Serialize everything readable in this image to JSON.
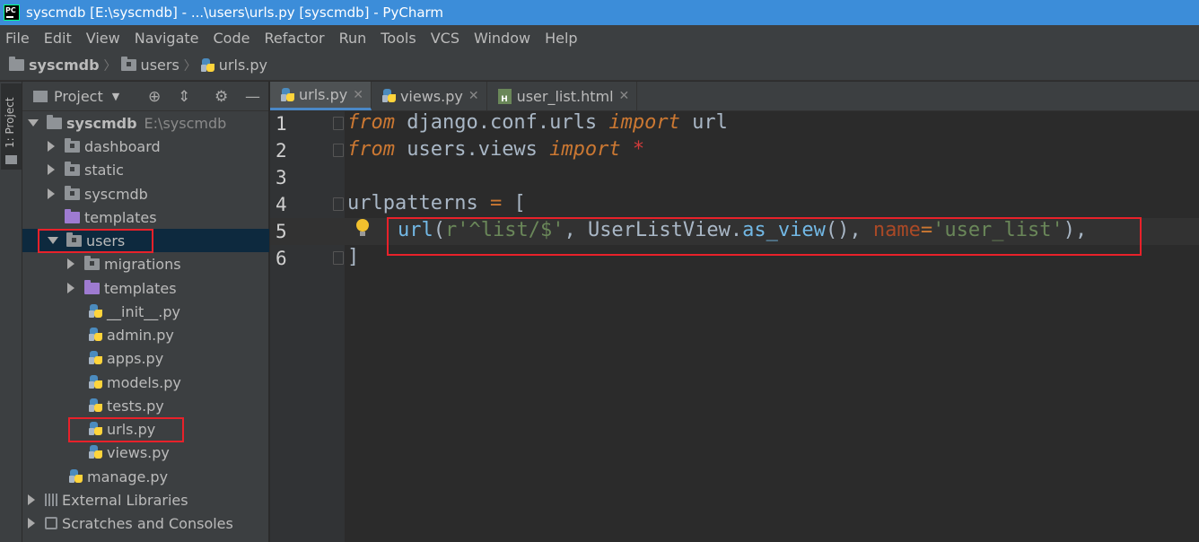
{
  "title": "syscmdb [E:\\syscmdb] - ...\\users\\urls.py [syscmdb] - PyCharm",
  "app_icon_text": "PC",
  "menu": [
    "File",
    "Edit",
    "View",
    "Navigate",
    "Code",
    "Refactor",
    "Run",
    "Tools",
    "VCS",
    "Window",
    "Help"
  ],
  "breadcrumb": [
    "syscmdb",
    "users",
    "urls.py"
  ],
  "toolstrip": {
    "project_tab": "1: Project"
  },
  "project_panel": {
    "header": "Project",
    "root_name": "syscmdb",
    "root_path": "E:\\syscmdb",
    "items": {
      "dashboard": "dashboard",
      "static": "static",
      "syscmdb": "syscmdb",
      "templates": "templates",
      "users": "users",
      "migrations": "migrations",
      "users_templates": "templates",
      "init": "__init__.py",
      "admin": "admin.py",
      "apps": "apps.py",
      "models": "models.py",
      "tests": "tests.py",
      "urls": "urls.py",
      "views": "views.py",
      "manage": "manage.py",
      "external_libraries": "External Libraries",
      "scratches": "Scratches and Consoles"
    }
  },
  "tabs": [
    "urls.py",
    "views.py",
    "user_list.html"
  ],
  "code": {
    "line_numbers": [
      "1",
      "2",
      "3",
      "4",
      "5",
      "6"
    ],
    "l1": {
      "kw1": "from",
      "mod": " django.conf.urls ",
      "kw2": "import",
      "name": " url"
    },
    "l2": {
      "kw1": "from",
      "mod": " users.views ",
      "kw2": "import",
      "star": " *"
    },
    "l4": {
      "name": "urlpatterns ",
      "eq": "=",
      "br": " ["
    },
    "l5": {
      "fn": "url",
      "p1": "(",
      "str1": "r'^list/$'",
      "p2": ", UserListView.",
      "meth": "as_view",
      "p3": "(), ",
      "param": "name",
      "eq": "=",
      "str2": "'user_list'",
      "p4": "),"
    },
    "l6": "]"
  }
}
